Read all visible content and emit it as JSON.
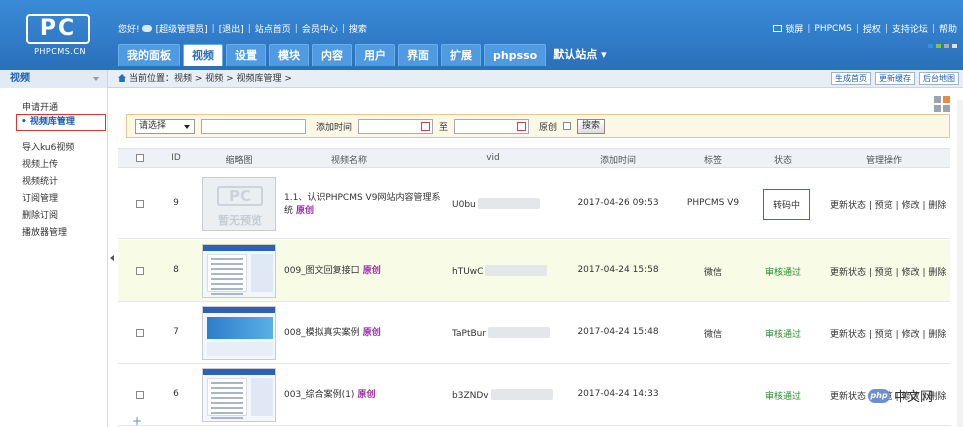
{
  "logo": {
    "mark": "PC",
    "text": "PHPCMS.CN"
  },
  "topbar": {
    "greeting": "您好!",
    "user": "[超级管理员]",
    "logout": "[退出]",
    "site_home": "站点首页",
    "member_center": "会员中心",
    "search": "搜索",
    "lock_screen": "锁屏",
    "brand": "PHPCMS",
    "license": "授权",
    "support": "支持论坛",
    "help": "帮助"
  },
  "nav": {
    "tabs": [
      "我的面板",
      "视频",
      "设置",
      "模块",
      "内容",
      "用户",
      "界面",
      "扩展",
      "phpsso"
    ],
    "active_index": 1,
    "site_selector": "默认站点"
  },
  "sidebar": {
    "heading": "视频",
    "items": [
      "申请开通",
      "• 视频库管理",
      "导入ku6视频",
      "视频上传",
      "视频统计",
      "订阅管理",
      "删除订阅",
      "播放器管理"
    ],
    "active_index": 1
  },
  "breadcrumb": "当前位置：视频 > 视频 > 视频库管理 >",
  "quick_buttons": [
    "生成首页",
    "更新缓存",
    "后台地图"
  ],
  "search_form": {
    "select_value": "请选择",
    "add_time_label": "添加时间",
    "to_label": "至",
    "original_label": "原创",
    "search_button": "搜索"
  },
  "table": {
    "headers": [
      "ID",
      "缩略图",
      "视频名称",
      "vid",
      "添加时间",
      "标签",
      "状态",
      "管理操作"
    ],
    "original_tag": "原创",
    "placeholder_thumb": {
      "mark": "PC",
      "text": "暂无预览"
    },
    "ops": [
      "更新状态",
      "预览",
      "修改",
      "删除"
    ],
    "rows": [
      {
        "id": "9",
        "title": "1.1、认识PHPCMS V9网站内容管理系统",
        "vid": "U0bu",
        "time": "2017-04-26 09:53",
        "tag": "PHPCMS V9",
        "status": "转码中"
      },
      {
        "id": "8",
        "title": "009_图文回复接口",
        "vid": "hTUwC",
        "time": "2017-04-24 15:58",
        "tag": "微信",
        "status": "审核通过"
      },
      {
        "id": "7",
        "title": "008_模拟真实案例",
        "vid": "TaPtBur",
        "time": "2017-04-24 15:48",
        "tag": "微信",
        "status": "审核通过"
      },
      {
        "id": "6",
        "title": "003_综合案例(1)",
        "vid": "b3ZNDv",
        "time": "2017-04-24 14:33",
        "tag": "",
        "status": "审核通过"
      }
    ]
  },
  "watermark": {
    "logo": "php",
    "text": "中文网"
  }
}
